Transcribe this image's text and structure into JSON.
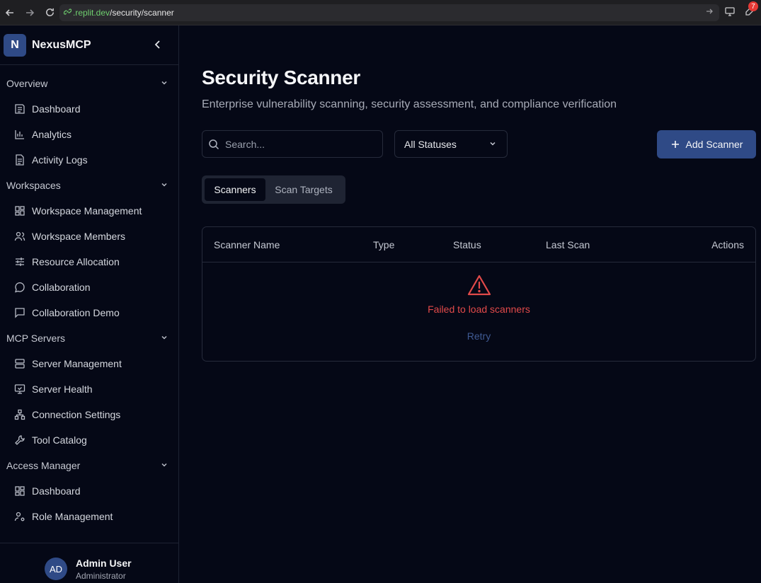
{
  "browser": {
    "url_host": ".replit.dev",
    "url_path": "/security/scanner",
    "extension_badge": "7"
  },
  "sidebar": {
    "brand_initial": "N",
    "brand_name": "NexusMCP",
    "sections": [
      {
        "title": "Overview",
        "items": [
          "Dashboard",
          "Analytics",
          "Activity Logs"
        ]
      },
      {
        "title": "Workspaces",
        "items": [
          "Workspace Management",
          "Workspace Members",
          "Resource Allocation",
          "Collaboration",
          "Collaboration Demo"
        ]
      },
      {
        "title": "MCP Servers",
        "items": [
          "Server Management",
          "Server Health",
          "Connection Settings",
          "Tool Catalog"
        ]
      },
      {
        "title": "Access Manager",
        "items": [
          "Dashboard",
          "Role Management"
        ]
      }
    ],
    "user": {
      "initials": "AD",
      "name": "Admin User",
      "role": "Administrator"
    }
  },
  "main": {
    "title": "Security Scanner",
    "subtitle": "Enterprise vulnerability scanning, security assessment, and compliance verification",
    "search_placeholder": "Search...",
    "status_filter": "All Statuses",
    "add_button": "Add Scanner",
    "tabs": [
      "Scanners",
      "Scan Targets"
    ],
    "table": {
      "columns": [
        "Scanner Name",
        "Type",
        "Status",
        "Last Scan",
        "Actions"
      ],
      "error_message": "Failed to load scanners",
      "retry_label": "Retry"
    }
  }
}
